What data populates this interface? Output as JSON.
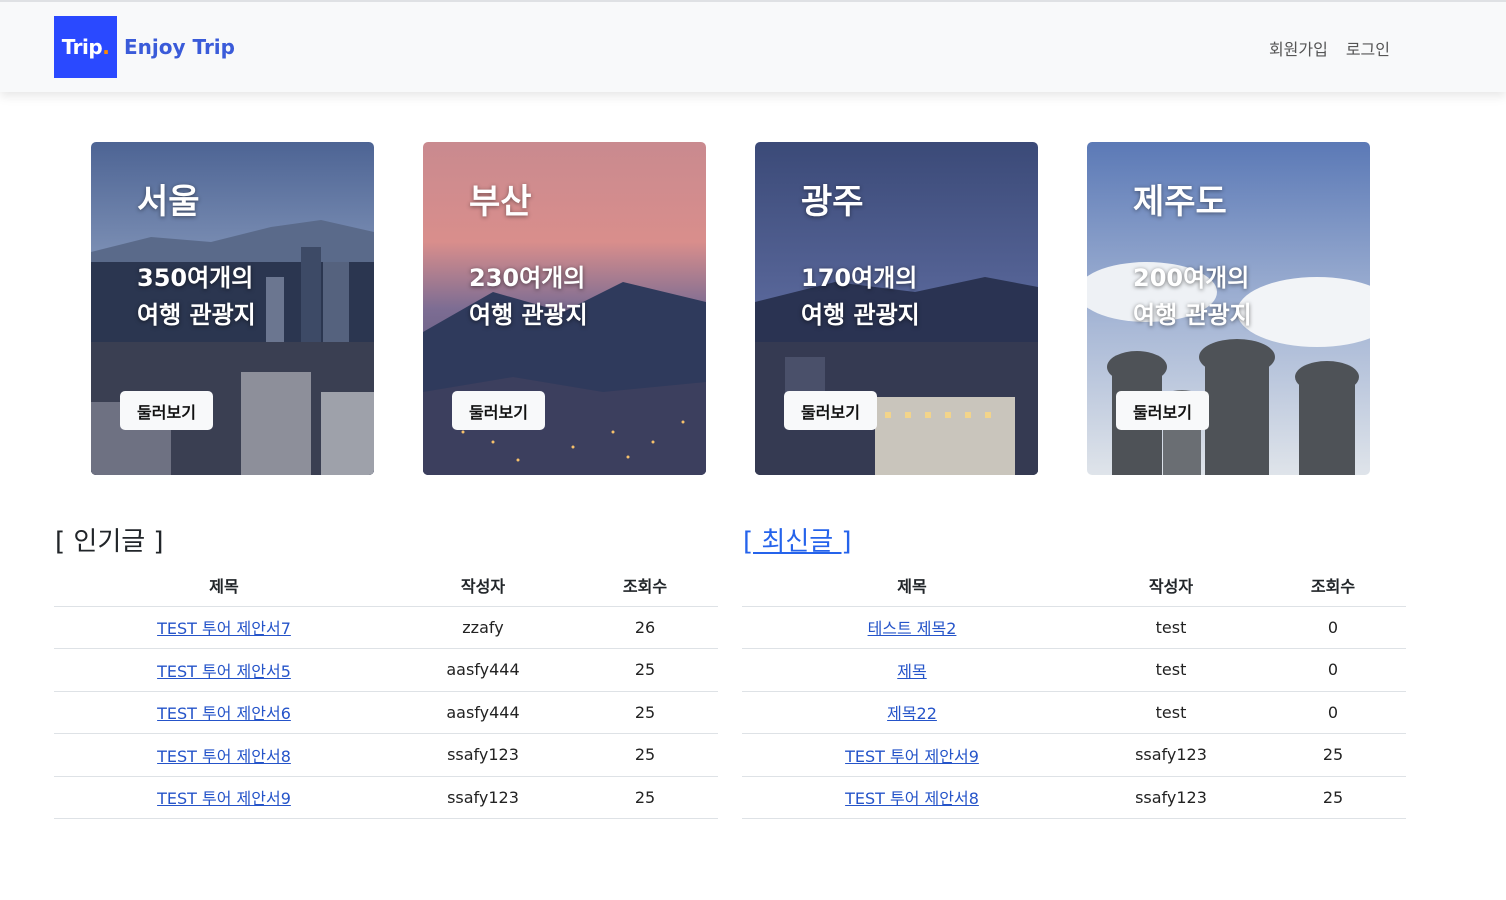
{
  "header": {
    "logo_text": "Trip",
    "logo_dot": ".",
    "brand_name": "Enjoy Trip",
    "nav": [
      {
        "label": "회원가입"
      },
      {
        "label": "로그인"
      }
    ]
  },
  "cards": [
    {
      "title": "서울",
      "line1": "350여개의",
      "line2": "여행 관광지",
      "button": "둘러보기"
    },
    {
      "title": "부산",
      "line1": "230여개의",
      "line2": "여행 관광지",
      "button": "둘러보기"
    },
    {
      "title": "광주",
      "line1": "170여개의",
      "line2": "여행 관광지",
      "button": "둘러보기"
    },
    {
      "title": "제주도",
      "line1": "200여개의",
      "line2": "여행 관광지",
      "button": "둘러보기"
    }
  ],
  "popular": {
    "title": "[ 인기글 ]",
    "headers": [
      "제목",
      "작성자",
      "조회수"
    ],
    "rows": [
      {
        "title": "TEST 투어 제안서7",
        "writer": "zzafy",
        "hits": "26"
      },
      {
        "title": "TEST 투어 제안서5",
        "writer": "aasfy444",
        "hits": "25"
      },
      {
        "title": "TEST 투어 제안서6",
        "writer": "aasfy444",
        "hits": "25"
      },
      {
        "title": "TEST 투어 제안서8",
        "writer": "ssafy123",
        "hits": "25"
      },
      {
        "title": "TEST 투어 제안서9",
        "writer": "ssafy123",
        "hits": "25"
      }
    ]
  },
  "latest": {
    "title": "[ 최신글 ]",
    "headers": [
      "제목",
      "작성자",
      "조회수"
    ],
    "rows": [
      {
        "title": "테스트 제목2",
        "writer": "test",
        "hits": "0"
      },
      {
        "title": "제목",
        "writer": "test",
        "hits": "0"
      },
      {
        "title": "제목22",
        "writer": "test",
        "hits": "0"
      },
      {
        "title": "TEST 투어 제안서9",
        "writer": "ssafy123",
        "hits": "25"
      },
      {
        "title": "TEST 투어 제안서8",
        "writer": "ssafy123",
        "hits": "25"
      }
    ]
  },
  "colors": {
    "logo_bg": "#2a49ff",
    "brand": "#3a5bd9",
    "link": "#2554c9"
  }
}
